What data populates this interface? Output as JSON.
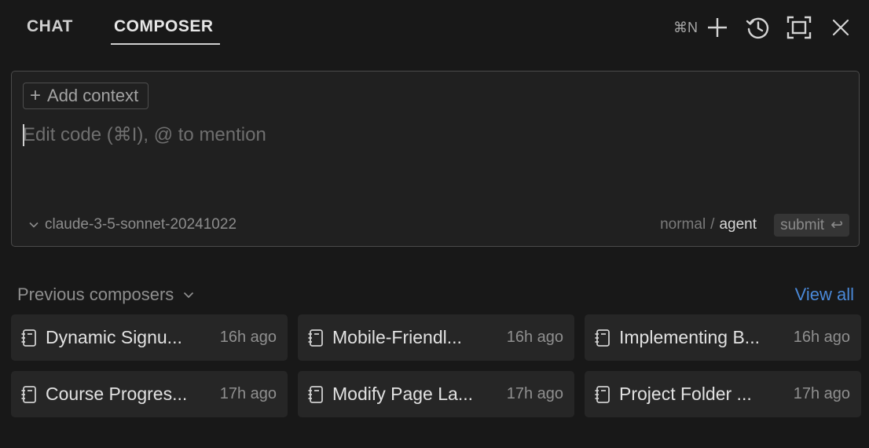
{
  "header": {
    "tabs": [
      {
        "label": "CHAT",
        "active": false
      },
      {
        "label": "COMPOSER",
        "active": true
      }
    ],
    "new_shortcut": "⌘N",
    "icons": [
      "plus-icon",
      "history-icon",
      "maximize-icon",
      "close-icon"
    ]
  },
  "composer": {
    "add_context_label": "Add context",
    "placeholder": "Edit code (⌘I), @ to mention",
    "model": "claude-3-5-sonnet-20241022",
    "mode_normal": "normal",
    "mode_separator": "/",
    "mode_agent": "agent",
    "active_mode": "agent",
    "submit_label": "submit",
    "submit_glyph": "↩"
  },
  "previous": {
    "header": "Previous composers",
    "view_all": "View all",
    "items": [
      {
        "title": "Dynamic Signu...",
        "time": "16h ago"
      },
      {
        "title": "Mobile-Friendl...",
        "time": "16h ago"
      },
      {
        "title": "Implementing B...",
        "time": "16h ago"
      },
      {
        "title": "Course Progres...",
        "time": "17h ago"
      },
      {
        "title": "Modify Page La...",
        "time": "17h ago"
      },
      {
        "title": "Project Folder ...",
        "time": "17h ago"
      }
    ]
  },
  "colors": {
    "background": "#181818",
    "panel": "#202020",
    "card": "#262626",
    "link": "#4a89d8"
  }
}
